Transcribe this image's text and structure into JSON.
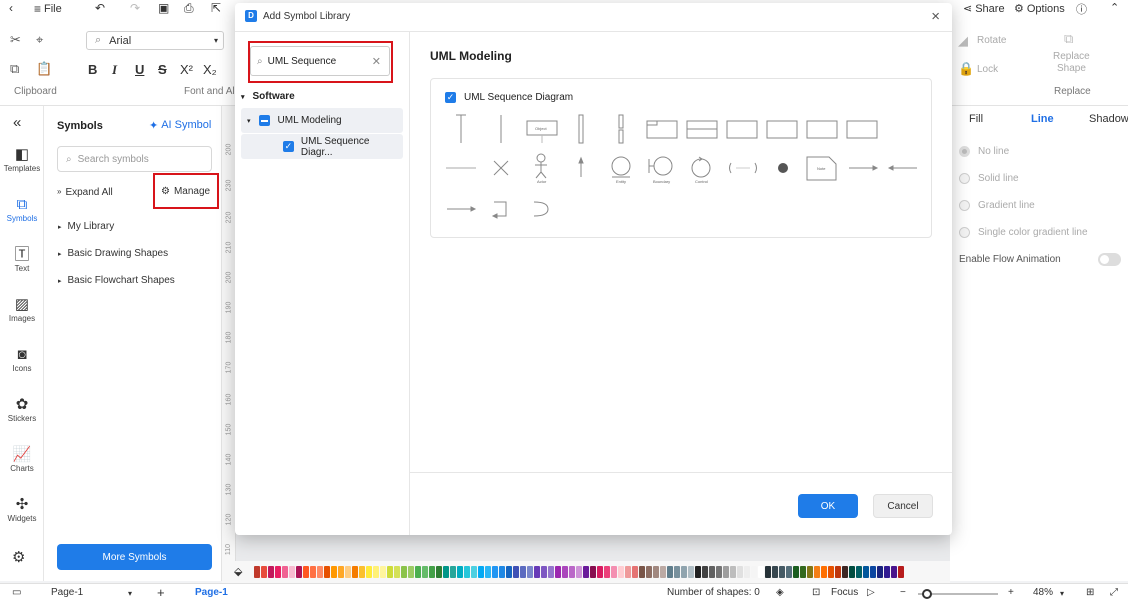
{
  "topbar": {
    "file": "File",
    "share": "Share",
    "options": "Options"
  },
  "ribbon": {
    "font_name": "Arial",
    "clipboard_label": "Clipboard",
    "font_align_label": "Font and Al",
    "rotate": "Rotate",
    "lock": "Lock",
    "replace_shape_line1": "Replace",
    "replace_shape_line2": "Shape",
    "replace_label": "Replace"
  },
  "rail": {
    "items": [
      {
        "label": "Templates",
        "icon": "templates-icon"
      },
      {
        "label": "Symbols",
        "icon": "symbols-icon"
      },
      {
        "label": "Text",
        "icon": "text-icon"
      },
      {
        "label": "Images",
        "icon": "images-icon"
      },
      {
        "label": "Icons",
        "icon": "icons-icon"
      },
      {
        "label": "Stickers",
        "icon": "stickers-icon"
      },
      {
        "label": "Charts",
        "icon": "charts-icon"
      },
      {
        "label": "Widgets",
        "icon": "widgets-icon"
      }
    ]
  },
  "symbols_panel": {
    "title": "Symbols",
    "ai_symbol": "AI Symbol",
    "search_placeholder": "Search symbols",
    "expand_all": "Expand All",
    "manage": "Manage",
    "libraries": [
      "My Library",
      "Basic Drawing Shapes",
      "Basic Flowchart Shapes"
    ],
    "more_symbols": "More Symbols"
  },
  "ruler": [
    "200",
    "230",
    "220",
    "210",
    "200",
    "190",
    "180",
    "170",
    "160",
    "150",
    "140",
    "130",
    "120",
    "110",
    "100"
  ],
  "right_panel": {
    "tabs": [
      "Fill",
      "Line",
      "Shadow"
    ],
    "active_tab": "Line",
    "options": [
      "No line",
      "Solid line",
      "Gradient line",
      "Single color gradient line"
    ],
    "flow_animation": "Enable Flow Animation"
  },
  "statusbar": {
    "page_select": "Page-1",
    "page_tab": "Page-1",
    "shape_count": "Number of shapes: 0",
    "focus": "Focus",
    "zoom": "48%"
  },
  "modal": {
    "title": "Add Symbol Library",
    "search_value": "UML Sequence",
    "category": "Software",
    "group": "UML Modeling",
    "item": "UML Sequence Diagr...",
    "right_title": "UML Modeling",
    "library_name": "UML Sequence Diagram",
    "ok": "OK",
    "cancel": "Cancel",
    "shape_labels": {
      "object": "Object",
      "actor": "Actor",
      "entity": "Entity",
      "boundary": "Boundary",
      "control": "Control",
      "note": "Note"
    }
  },
  "colors": {
    "accent": "#1f7ce8",
    "highlight": "#d8141a",
    "swatches": [
      "#c0392b",
      "#e74c3c",
      "#c2185b",
      "#e91e63",
      "#f06292",
      "#f8bbd0",
      "#ad1457",
      "#ff5722",
      "#ff7043",
      "#ff8a65",
      "#e65100",
      "#ff9800",
      "#ffa726",
      "#ffcc80",
      "#f57c00",
      "#fbc02d",
      "#ffeb3b",
      "#fff176",
      "#fff59d",
      "#cddc39",
      "#d4e157",
      "#8bc34a",
      "#9ccc65",
      "#4caf50",
      "#66bb6a",
      "#43a047",
      "#2e7d32",
      "#009688",
      "#26a69a",
      "#00acc1",
      "#26c6da",
      "#4dd0e1",
      "#03a9f4",
      "#29b6f6",
      "#2196f3",
      "#1e88e5",
      "#1565c0",
      "#3f51b5",
      "#5c6bc0",
      "#7986cb",
      "#673ab7",
      "#7e57c2",
      "#9575cd",
      "#9c27b0",
      "#ab47bc",
      "#ba68c8",
      "#ce93d8",
      "#6a1b9a",
      "#880e4f",
      "#d81b60",
      "#ec407a",
      "#f48fb1",
      "#ffcdd2",
      "#ef9a9a",
      "#e57373",
      "#795548",
      "#8d6e63",
      "#a1887f",
      "#bcaaa4",
      "#607d8b",
      "#78909c",
      "#90a4ae",
      "#b0bec5",
      "#212121",
      "#424242",
      "#616161",
      "#757575",
      "#9e9e9e",
      "#bdbdbd",
      "#e0e0e0",
      "#eeeeee",
      "#f5f5f5",
      "#ffffff",
      "#263238",
      "#37474f",
      "#455a64",
      "#546e7a",
      "#1b5e20",
      "#33691e",
      "#827717",
      "#f57f17",
      "#ff6f00",
      "#e65100",
      "#bf360c",
      "#3e2723",
      "#004d40",
      "#006064",
      "#01579b",
      "#0d47a1",
      "#1a237e",
      "#311b92",
      "#4a148c",
      "#b71c1c"
    ]
  }
}
